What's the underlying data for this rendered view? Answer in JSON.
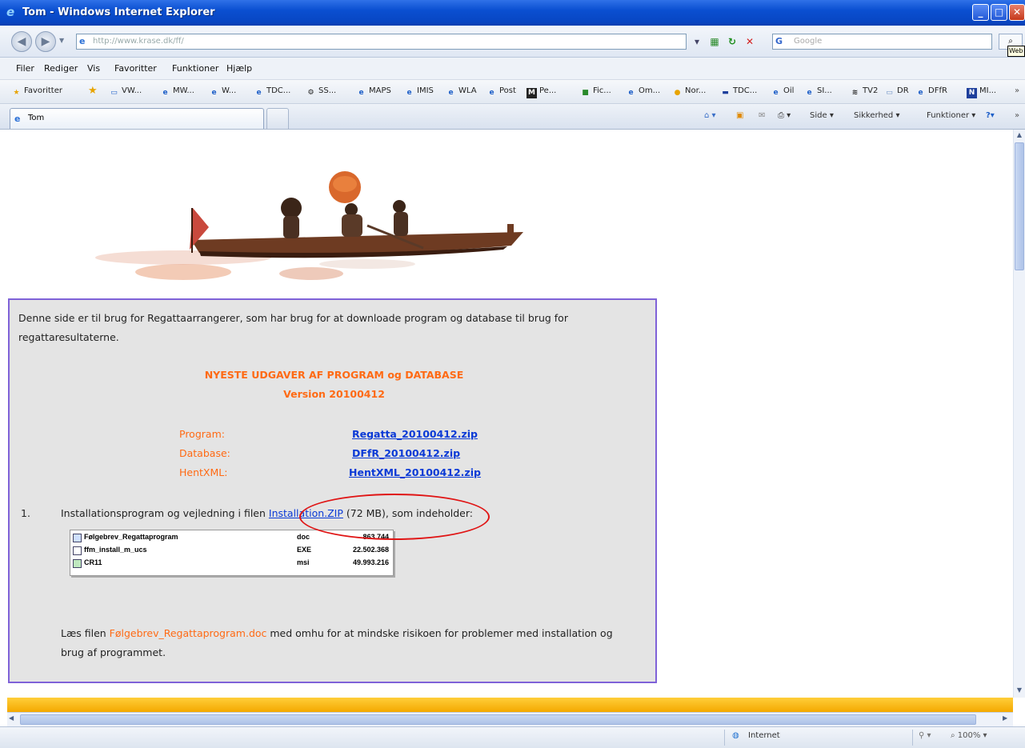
{
  "window": {
    "title": "Tom - Windows Internet Explorer",
    "colors": {
      "titlebar": "#0a4fd1",
      "panel_border": "#7f62d8",
      "orange_text": "#ff6a14",
      "link": "#0a3ad6",
      "highlight_ellipse": "#e01515",
      "bottom_bar": "#f4a900"
    }
  },
  "address_bar": {
    "url": "http://www.krase.dk/ff/",
    "search_placeholder": "Google",
    "tooltip": "Web"
  },
  "menu": [
    "Filer",
    "Rediger",
    "Vis",
    "Favoritter",
    "Funktioner",
    "Hjælp"
  ],
  "favorites": {
    "label": "Favoritter",
    "items": [
      "VW...",
      "MW...",
      "W...",
      "TDC...",
      "SS...",
      "MAPS",
      "IMIS",
      "WLA",
      "Post",
      "Pe...",
      "Fic...",
      "Om...",
      "Nor...",
      "TDC...",
      "Oil",
      "SI...",
      "TV2",
      "DR",
      "DFfR",
      "MI..."
    ]
  },
  "tab": {
    "label": "Tom"
  },
  "command_bar": {
    "side": "Side",
    "security": "Sikkerhed",
    "tools": "Funktioner"
  },
  "page": {
    "intro": "Denne side er til brug for Regattaarrangerer, som har brug for at downloade program og database til brug for regattaresultaterne.",
    "heading_line1": "NYESTE UDGAVER AF PROGRAM og DATABASE",
    "heading_line2": "Version 20100412",
    "downloads": [
      {
        "label": "Program:",
        "file": "Regatta_20100412.zip"
      },
      {
        "label": "Database:",
        "file": "DFfR_20100412.zip"
      },
      {
        "label": "HentXML:",
        "file": "HentXML_20100412.zip"
      }
    ],
    "step1": {
      "number": "1.",
      "text_before": "Installationsprogram og vejledning i filen ",
      "link": "Installation.ZIP",
      "text_after": " (72 MB), som indeholder:"
    },
    "file_listing": [
      {
        "name": "Følgebrev_Regattaprogram",
        "type": "doc",
        "size": "863.744"
      },
      {
        "name": "ffm_install_m_ucs",
        "type": "EXE",
        "size": "22.502.368"
      },
      {
        "name": "CR11",
        "type": "msi",
        "size": "49.993.216"
      }
    ],
    "note_before": "Læs filen ",
    "note_file": "Følgebrev_Regattaprogram.doc",
    "note_after": " med omhu for at mindske risikoen for problemer med installation og brug af programmet."
  },
  "status_bar": {
    "zone": "Internet",
    "zoom": "100%"
  }
}
